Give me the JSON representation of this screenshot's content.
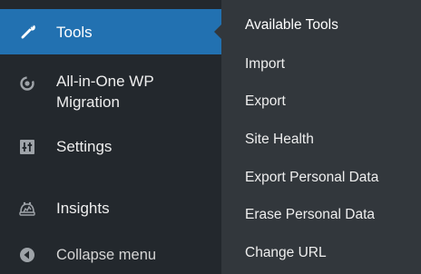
{
  "sidebar": {
    "items": [
      {
        "label": "Tools",
        "icon": "wrench-icon",
        "current": true
      },
      {
        "label": "All-in-One WP Migration",
        "icon": "migration-icon"
      },
      {
        "label": "Settings",
        "icon": "settings-sliders-icon"
      },
      {
        "label": "Insights",
        "icon": "insights-icon"
      }
    ],
    "collapse": {
      "label": "Collapse menu",
      "icon": "collapse-arrow-icon"
    }
  },
  "submenu": {
    "items": [
      {
        "label": "Available Tools"
      },
      {
        "label": "Import"
      },
      {
        "label": "Export"
      },
      {
        "label": "Site Health"
      },
      {
        "label": "Export Personal Data"
      },
      {
        "label": "Erase Personal Data"
      },
      {
        "label": "Change URL"
      }
    ]
  },
  "colors": {
    "sidebar_bg": "#23282d",
    "submenu_bg": "#32373c",
    "current_bg": "#2271b1",
    "text": "#eeeeee"
  }
}
